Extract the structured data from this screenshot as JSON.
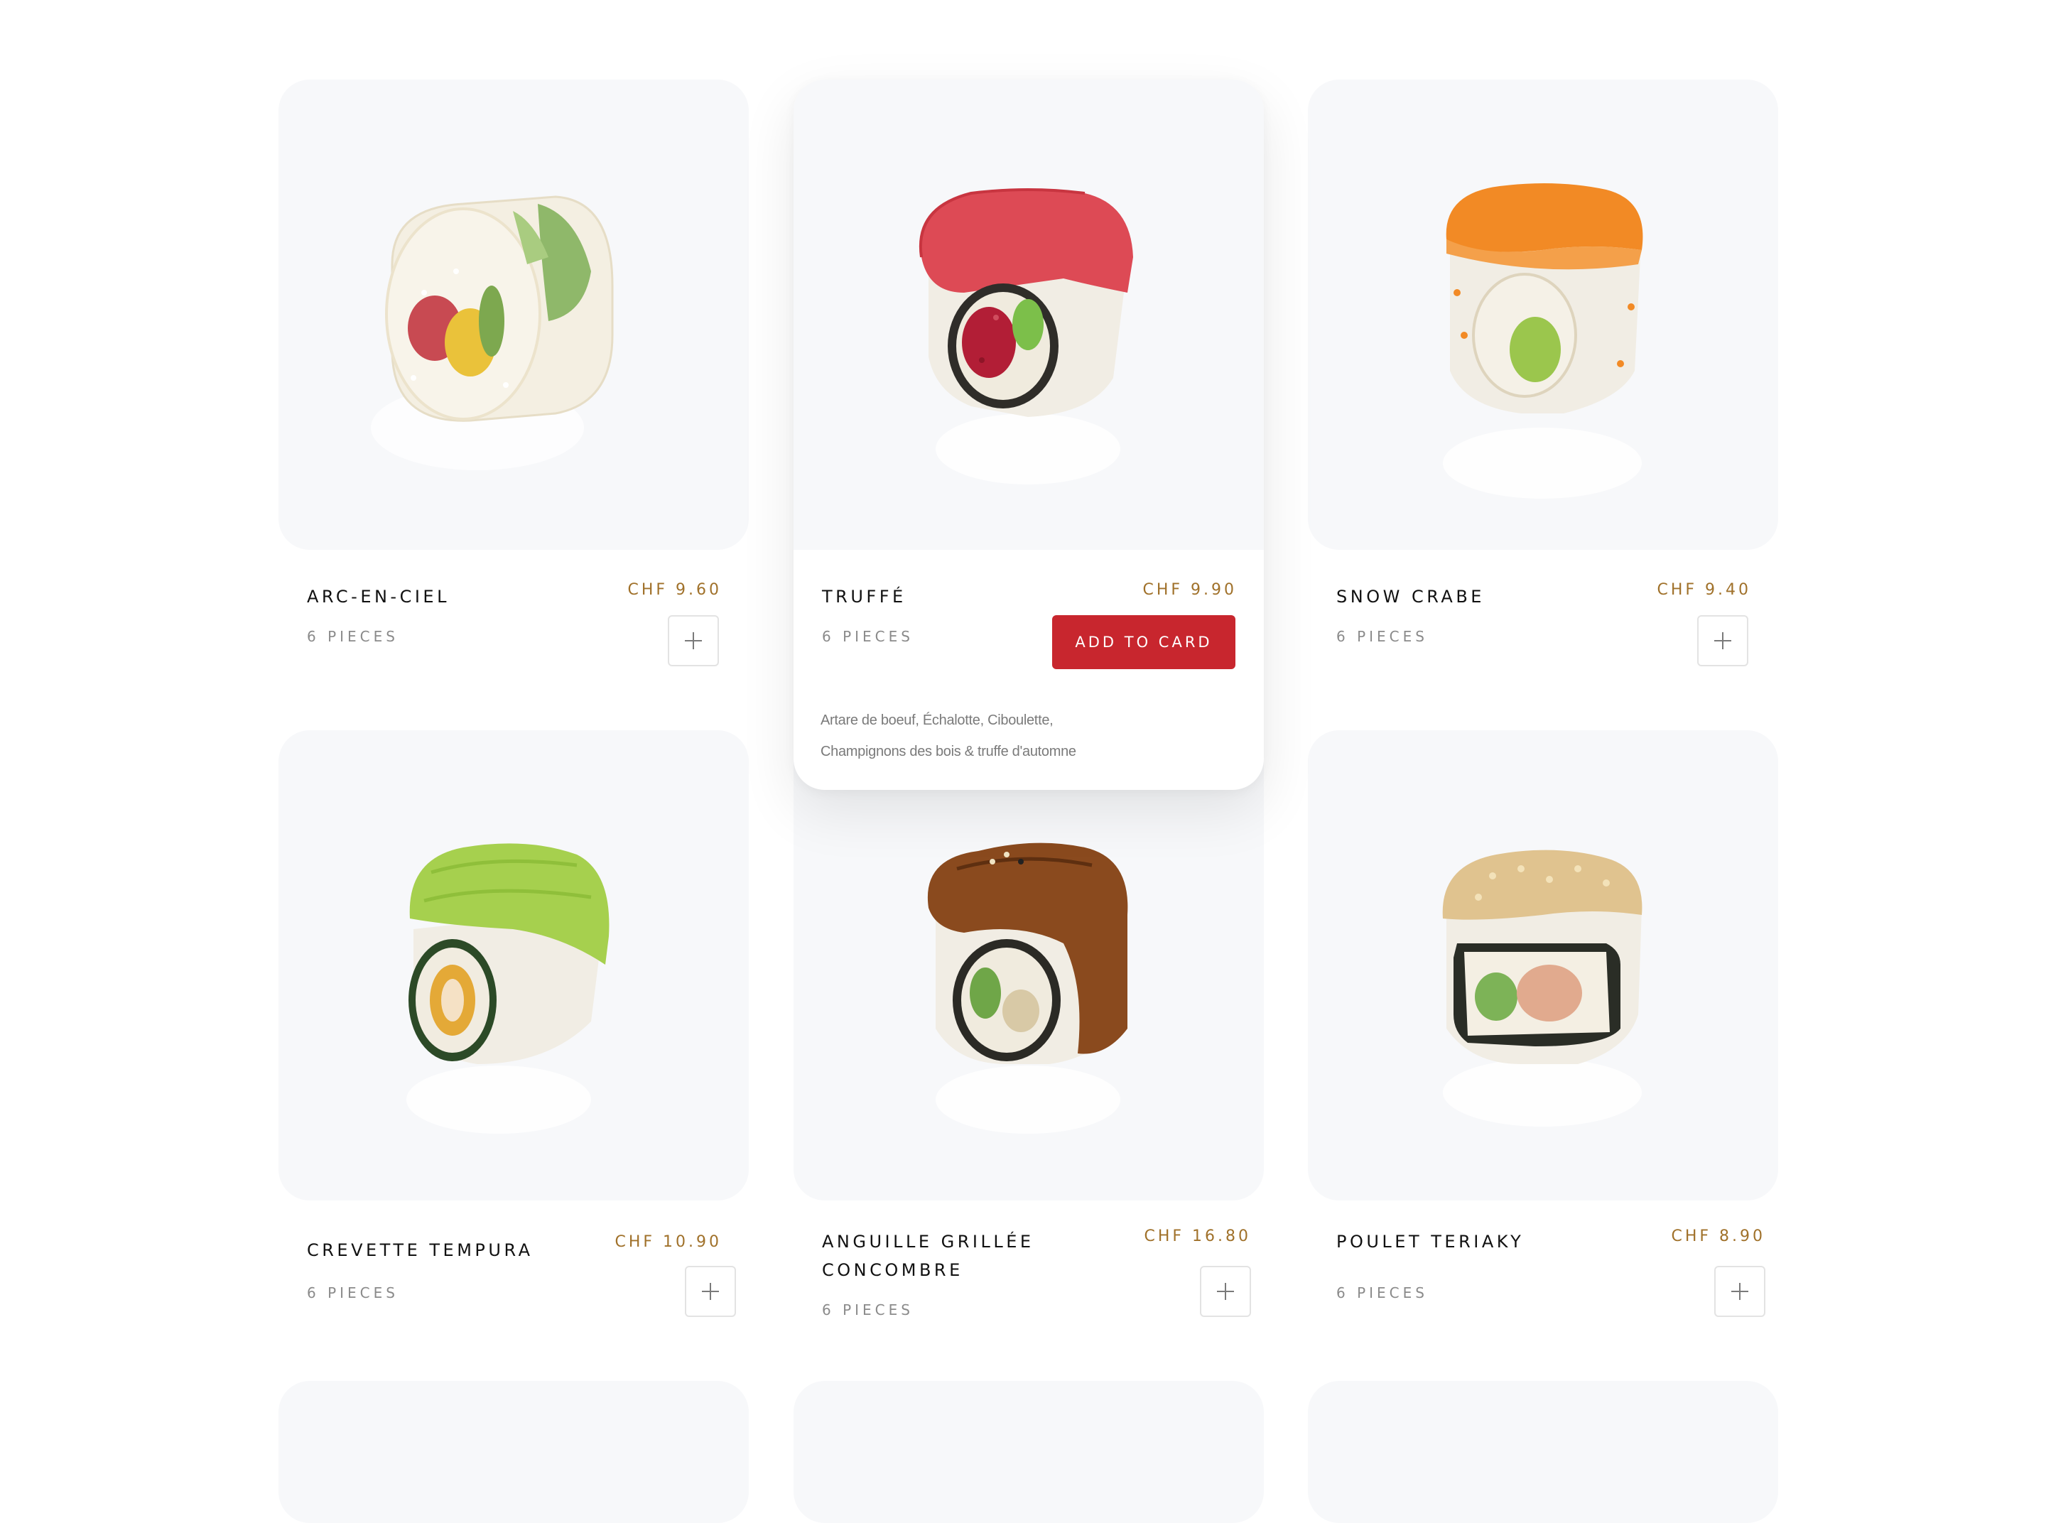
{
  "colors": {
    "accent": "#c8262e",
    "price": "#a0712a",
    "image_bg": "#f7f8fa"
  },
  "products": [
    {
      "name": "ARC-EN-CIEL",
      "price": "CHF 9.60",
      "pieces": "6 PIECES",
      "image": "rainbow-roll"
    },
    {
      "name": "TRUFFÉ",
      "price": "CHF 9.90",
      "pieces": "6 PIECES",
      "image": "tuna-truffle-roll",
      "add_label": "ADD TO CARD",
      "description_lines": [
        "Artare de boeuf, Échalotte, Ciboulette,",
        "Champignons des bois & truffe d'automne"
      ]
    },
    {
      "name": "SNOW CRABE",
      "price": "CHF 9.40",
      "pieces": "6 PIECES",
      "image": "snow-crab-roll"
    },
    {
      "name": "CREVETTE TEMPURA",
      "price": "CHF 10.90",
      "pieces": "6 PIECES",
      "image": "avocado-tempura-roll"
    },
    {
      "name_lines": [
        "ANGUILLE GRILLÉE",
        "CONCOMBRE"
      ],
      "price": "CHF 16.80",
      "pieces": "6 PIECES",
      "image": "grilled-eel-roll"
    },
    {
      "name": "POULET TERIAKY",
      "price": "CHF 8.90",
      "pieces": "6 PIECES",
      "image": "sesame-chicken-roll"
    }
  ]
}
